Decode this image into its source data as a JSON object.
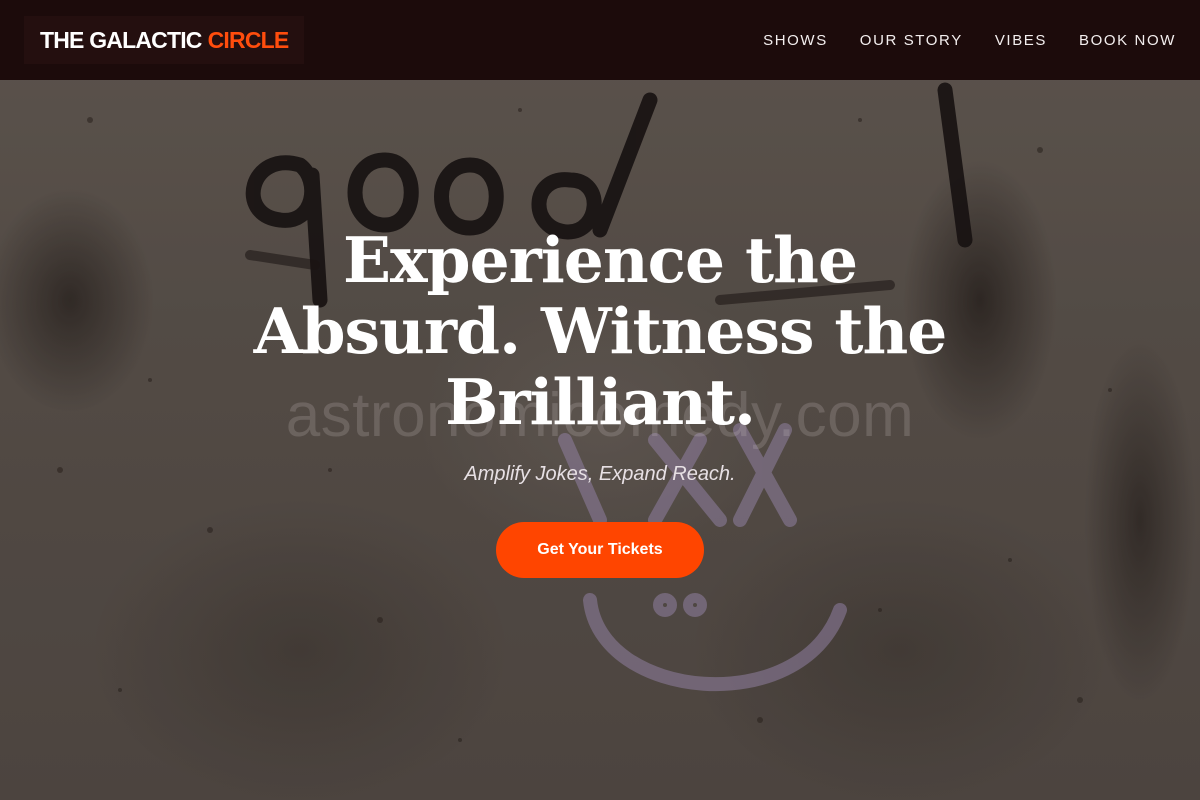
{
  "brand": {
    "name_white": "THE GALACTIC",
    "name_accent": "CIRCLE",
    "accent_color": "#ff4d0d"
  },
  "nav": {
    "items": [
      {
        "label": "SHOWS"
      },
      {
        "label": "OUR STORY"
      },
      {
        "label": "VIBES"
      },
      {
        "label": "BOOK NOW"
      }
    ]
  },
  "hero": {
    "title_lines": [
      "Experience the",
      "Absurd. Witness the",
      "Brilliant."
    ],
    "subtitle": "Amplify Jokes, Expand Reach.",
    "cta_label": "Get Your Tickets",
    "watermark": "astronomicomedy.com",
    "background": "textured-wall-graffiti-image"
  },
  "colors": {
    "navbar": "#1c0b0b",
    "cta": "#ff4500",
    "text": "#ffffff"
  }
}
